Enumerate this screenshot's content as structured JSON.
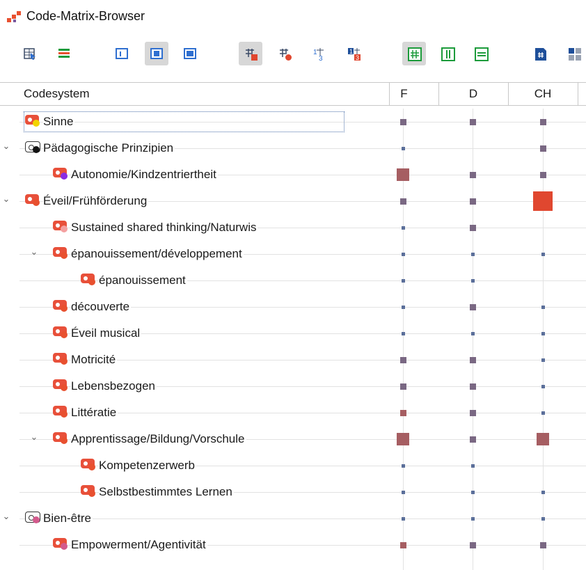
{
  "window": {
    "title": "Code-Matrix-Browser"
  },
  "toolbar": {
    "buttons": [
      {
        "icon": "select-rows-icon",
        "active": false
      },
      {
        "icon": "color-bars-icon",
        "active": false
      },
      {
        "icon": "window-left-icon",
        "active": false
      },
      {
        "icon": "window-center-icon",
        "active": true
      },
      {
        "icon": "window-full-icon",
        "active": false
      },
      {
        "icon": "symbol-squares-icon",
        "active": true
      },
      {
        "icon": "symbol-circles-icon",
        "active": false
      },
      {
        "icon": "numbers-icon",
        "active": false
      },
      {
        "icon": "numbers-highlight-icon",
        "active": false
      },
      {
        "icon": "grid-hash-icon",
        "active": true
      },
      {
        "icon": "columns-icon",
        "active": false
      },
      {
        "icon": "rows-icon",
        "active": false
      },
      {
        "icon": "count-hash-icon",
        "active": false
      },
      {
        "icon": "number-grid-icon",
        "active": false
      }
    ]
  },
  "grid": {
    "header": {
      "first": "Codesystem",
      "columns": [
        "F",
        "D",
        "CH"
      ]
    },
    "colors": {
      "small": "#5b6f9a",
      "medium": "#7a6883",
      "large": "#a65e62",
      "max": "#e0472f"
    },
    "rows": [
      {
        "label": "Sinne",
        "level": 1,
        "expander": "",
        "tag": "#e8503a",
        "dot": "#f2d400",
        "selected": true,
        "cells": [
          2,
          2,
          2
        ]
      },
      {
        "label": "Pädagogische Prinzipien",
        "level": 1,
        "expander": "⌄",
        "tag": "#ffffff",
        "dot": "#111111",
        "outline": true,
        "cells": [
          1,
          0,
          2
        ]
      },
      {
        "label": "Autonomie/Kindzentriertheit",
        "level": 2,
        "expander": "",
        "tag": "#e8503a",
        "dot": "#8a2be2",
        "cells": [
          4,
          2,
          2
        ]
      },
      {
        "label": "Éveil/Frühförderung",
        "level": 1,
        "expander": "⌄",
        "tag": "#e8503a",
        "dot": "#e8502f",
        "cells": [
          2,
          2,
          5
        ]
      },
      {
        "label": "Sustained shared thinking/Naturwis",
        "level": 2,
        "expander": "",
        "tag": "#e8503a",
        "dot": "#f4a0a0",
        "cells": [
          1,
          2,
          0
        ]
      },
      {
        "label": "épanouissement/développement",
        "level": 2,
        "expander": "⌄",
        "tag": "#e8503a",
        "dot": "#e8502f",
        "cells": [
          1,
          1,
          1
        ]
      },
      {
        "label": "épanouissement",
        "level": 3,
        "expander": "",
        "tag": "#e8503a",
        "dot": "#e8502f",
        "cells": [
          1,
          1,
          0
        ]
      },
      {
        "label": "découverte",
        "level": 2,
        "expander": "",
        "tag": "#e8503a",
        "dot": "#e8502f",
        "cells": [
          1,
          2,
          1
        ]
      },
      {
        "label": "Éveil musical",
        "level": 2,
        "expander": "",
        "tag": "#e8503a",
        "dot": "#e8502f",
        "cells": [
          1,
          1,
          1
        ]
      },
      {
        "label": "Motricité",
        "level": 2,
        "expander": "",
        "tag": "#e8503a",
        "dot": "#e8502f",
        "cells": [
          2,
          2,
          1
        ]
      },
      {
        "label": "Lebensbezogen",
        "level": 2,
        "expander": "",
        "tag": "#e8503a",
        "dot": "#e8502f",
        "cells": [
          2,
          2,
          1
        ]
      },
      {
        "label": "Littératie",
        "level": 2,
        "expander": "",
        "tag": "#e8503a",
        "dot": "#e8502f",
        "cells": [
          3,
          2,
          1
        ]
      },
      {
        "label": "Apprentissage/Bildung/Vorschule",
        "level": 2,
        "expander": "⌄",
        "tag": "#e8503a",
        "dot": "#e8502f",
        "cells": [
          4,
          2,
          4
        ]
      },
      {
        "label": "Kompetenzerwerb",
        "level": 3,
        "expander": "",
        "tag": "#e8503a",
        "dot": "#e8502f",
        "cells": [
          1,
          1,
          0
        ]
      },
      {
        "label": "Selbstbestimmtes Lernen",
        "level": 3,
        "expander": "",
        "tag": "#e8503a",
        "dot": "#e8502f",
        "cells": [
          1,
          1,
          1
        ]
      },
      {
        "label": "Bien-être",
        "level": 1,
        "expander": "⌄",
        "tag": "#ffffff",
        "dot": "#d35a8c",
        "outline": true,
        "cells": [
          1,
          1,
          1
        ]
      },
      {
        "label": "Empowerment/Agentivität",
        "level": 2,
        "expander": "",
        "tag": "#e8503a",
        "dot": "#d35a8c",
        "cells": [
          3,
          2,
          2
        ]
      }
    ]
  }
}
